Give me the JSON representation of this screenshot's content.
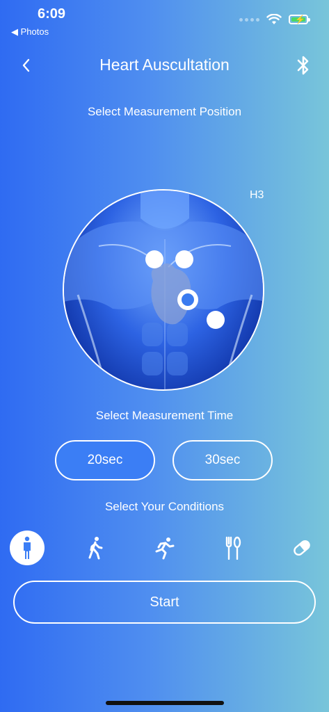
{
  "status_bar": {
    "time": "6:09",
    "back_app": "◀ Photos"
  },
  "header": {
    "title": "Heart Auscultation"
  },
  "position": {
    "label": "Select Measurement Position",
    "selected_point": "H3"
  },
  "time_select": {
    "label": "Select Measurement Time",
    "options": [
      {
        "label": "20sec",
        "active": true
      },
      {
        "label": "30sec",
        "active": false
      }
    ]
  },
  "conditions": {
    "label": "Select Your Conditions",
    "items": [
      {
        "icon": "standing-person-icon",
        "active": true
      },
      {
        "icon": "walking-person-icon",
        "active": false
      },
      {
        "icon": "running-person-icon",
        "active": false
      },
      {
        "icon": "fork-spoon-icon",
        "active": false
      },
      {
        "icon": "pill-icon",
        "active": false
      }
    ]
  },
  "start": {
    "label": "Start"
  },
  "colors": {
    "accent": "#3b7ef5",
    "gradient_start": "#2f6bf2",
    "gradient_end": "#78c5da"
  }
}
